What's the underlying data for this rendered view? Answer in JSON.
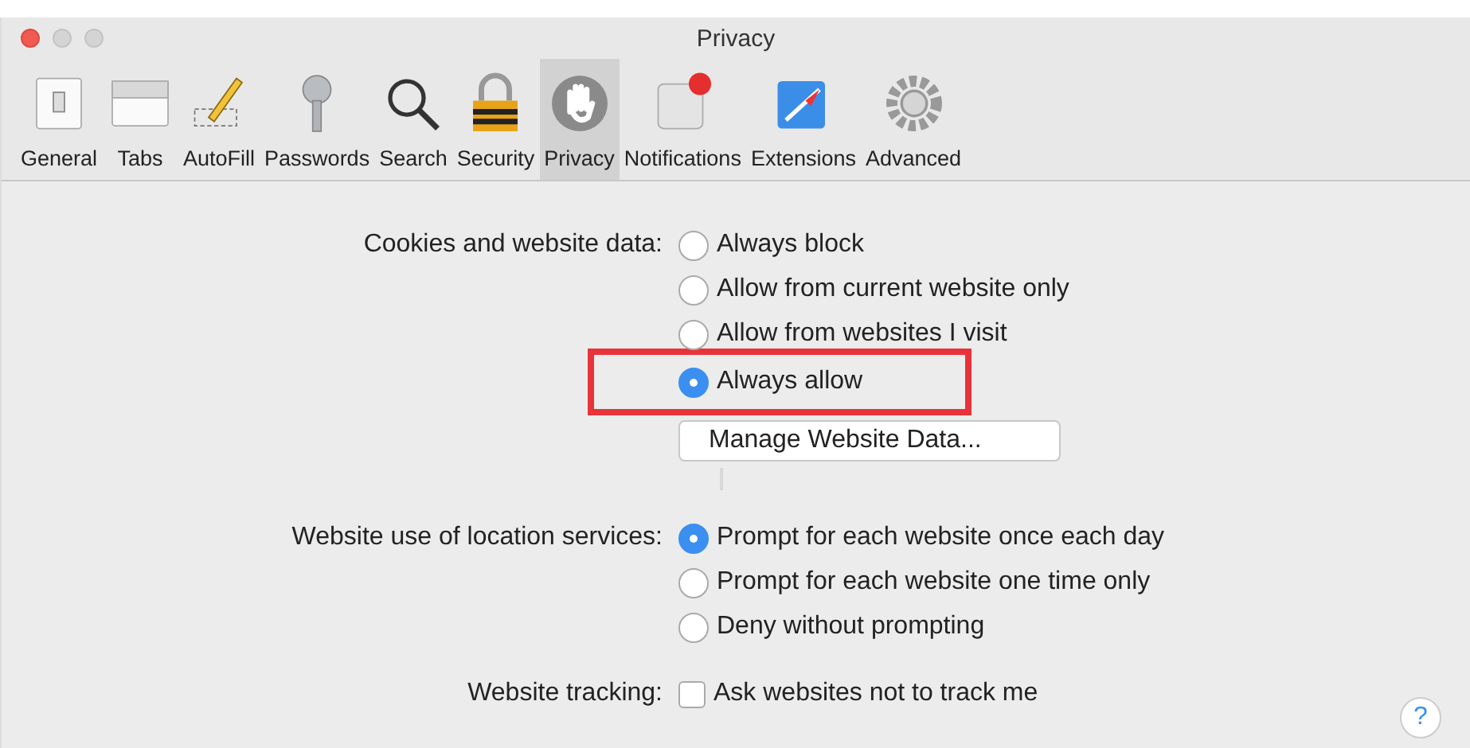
{
  "window": {
    "title": "Privacy"
  },
  "toolbar": [
    {
      "label": "General",
      "selected": false
    },
    {
      "label": "Tabs",
      "selected": false
    },
    {
      "label": "AutoFill",
      "selected": false
    },
    {
      "label": "Passwords",
      "selected": false
    },
    {
      "label": "Search",
      "selected": false
    },
    {
      "label": "Security",
      "selected": false
    },
    {
      "label": "Privacy",
      "selected": true
    },
    {
      "label": "Notifications",
      "selected": false
    },
    {
      "label": "Extensions",
      "selected": false
    },
    {
      "label": "Advanced",
      "selected": false
    }
  ],
  "sections": [
    {
      "kind": "radio",
      "label": "Cookies and website data:",
      "options": [
        {
          "label": "Always block",
          "selected": false,
          "highlighted": false
        },
        {
          "label": "Allow from current website only",
          "selected": false,
          "highlighted": false
        },
        {
          "label": "Allow from websites I visit",
          "selected": false,
          "highlighted": false
        },
        {
          "label": "Always allow",
          "selected": true,
          "highlighted": true
        }
      ],
      "button": "Manage Website Data..."
    },
    {
      "kind": "radio",
      "label": "Website use of location services:",
      "options": [
        {
          "label": "Prompt for each website once each day",
          "selected": true,
          "highlighted": false
        },
        {
          "label": "Prompt for each website one time only",
          "selected": false,
          "highlighted": false
        },
        {
          "label": "Deny without prompting",
          "selected": false,
          "highlighted": false
        }
      ]
    },
    {
      "kind": "checkbox",
      "label": "Website tracking:",
      "options": [
        {
          "label": "Ask websites not to track me",
          "checked": false
        }
      ]
    }
  ],
  "help": "?"
}
